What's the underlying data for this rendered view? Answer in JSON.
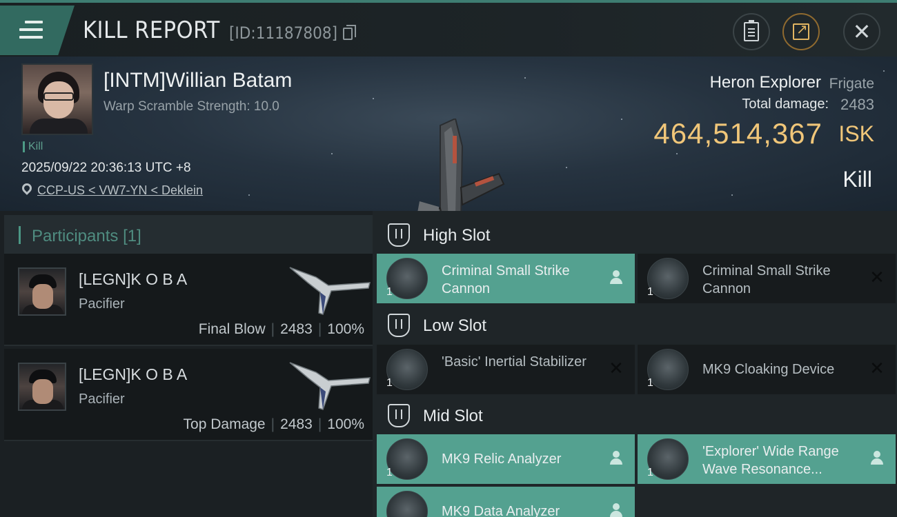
{
  "header": {
    "title": "KILL REPORT",
    "report_id": "[ID:11187808]"
  },
  "victim": {
    "name": "[INTM]Willian Batam",
    "warp_scramble": "Warp Scramble Strength: 10.0",
    "tag": "Kill",
    "datetime": "2025/09/22 20:36:13 UTC +8",
    "location": "CCP-US < VW7-YN < Deklein",
    "ship_name": "Heron Explorer",
    "ship_class": "Frigate",
    "total_damage_label": "Total damage:",
    "total_damage": "2483",
    "isk_value": "464,514,367",
    "isk_unit": "ISK",
    "kill_type": "Kill"
  },
  "participants": {
    "title": "Participants",
    "count": "[1]",
    "items": [
      {
        "name": "[LEGN]K O B A",
        "ship": "Pacifier",
        "role": "Final Blow",
        "damage": "2483",
        "percent": "100%"
      },
      {
        "name": "[LEGN]K O B A",
        "ship": "Pacifier",
        "role": "Top Damage",
        "damage": "2483",
        "percent": "100%"
      }
    ]
  },
  "slots": {
    "high": {
      "title": "High Slot",
      "modules": [
        {
          "name": "Criminal Small Strike Cannon",
          "qty": "1",
          "status": "dropped"
        },
        {
          "name": "Criminal Small Strike Cannon",
          "qty": "1",
          "status": "destroyed"
        }
      ]
    },
    "low": {
      "title": "Low Slot",
      "modules": [
        {
          "name": "'Basic' Inertial Stabilizer",
          "qty": "1",
          "status": "destroyed"
        },
        {
          "name": "MK9 Cloaking Device",
          "qty": "1",
          "status": "destroyed"
        }
      ]
    },
    "mid": {
      "title": "Mid Slot",
      "modules": [
        {
          "name": "MK9 Relic Analyzer",
          "qty": "1",
          "status": "dropped"
        },
        {
          "name": "'Explorer' Wide Range Wave Resonance...",
          "qty": "1",
          "status": "dropped"
        },
        {
          "name": "MK9 Data Analyzer",
          "qty": "",
          "status": "dropped"
        }
      ]
    }
  },
  "colors": {
    "accent": "#4c9785",
    "dropped": "#54a190",
    "isk": "#f0c679",
    "share_ring": "#8f6a2f"
  },
  "icons": [
    "menu-icon",
    "copy-icon",
    "report-icon",
    "share-icon",
    "close-icon",
    "location-pin-icon",
    "slot-icon",
    "person-icon",
    "x-icon"
  ]
}
